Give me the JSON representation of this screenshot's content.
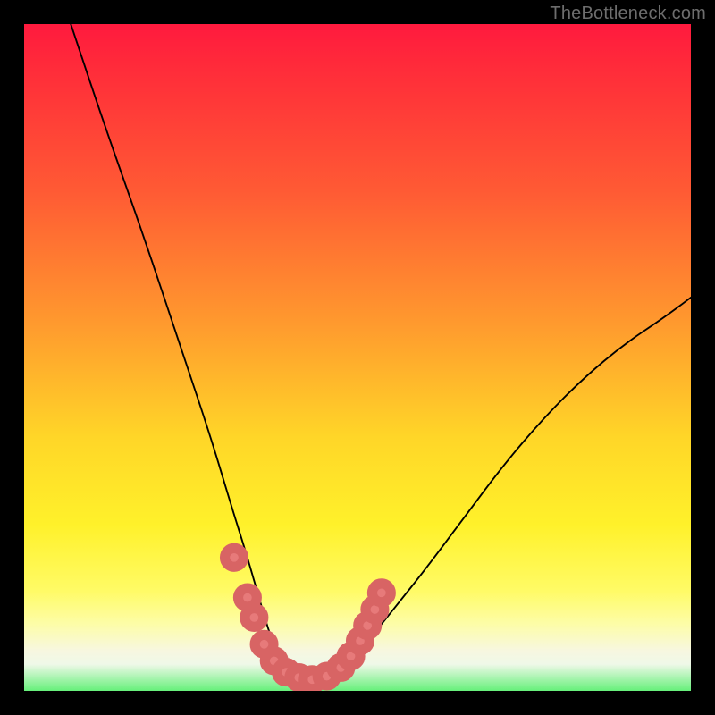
{
  "watermark": "TheBottleneck.com",
  "colors": {
    "frame": "#000000",
    "gradient_stops": [
      "#ff1a3e",
      "#ff2a3a",
      "#ff5a34",
      "#ff9a2e",
      "#ffd628",
      "#fff12a",
      "#fffb66",
      "#fdfda8",
      "#f7f7e0",
      "#eff8e8",
      "#66f07a"
    ],
    "curve": "#000000",
    "marker_fill": "#e77a7a",
    "marker_stroke": "#d86464"
  },
  "chart_data": {
    "type": "line",
    "title": "",
    "xlabel": "",
    "ylabel": "",
    "xlim": [
      0,
      100
    ],
    "ylim": [
      0,
      100
    ],
    "grid": false,
    "legend": false,
    "note": "percent-of-plot coordinates (0,0)=top-left; x/y are 0–100",
    "series": [
      {
        "name": "bottleneck-curve",
        "x": [
          7,
          12,
          18,
          24,
          28,
          31,
          33.5,
          35.5,
          37,
          38.5,
          40,
          42.5,
          45,
          48,
          52,
          56,
          60,
          66,
          72,
          78,
          84,
          90,
          96,
          100
        ],
        "y": [
          0,
          15,
          32,
          50,
          62,
          72,
          80,
          87,
          92,
          95.5,
          97.2,
          98.2,
          98,
          96,
          92,
          87,
          82,
          74,
          66,
          59,
          53,
          48,
          44,
          41
        ]
      }
    ],
    "markers": {
      "name": "highlight-dots",
      "radius_pct": 1.4,
      "points": [
        {
          "x": 31.5,
          "y": 80
        },
        {
          "x": 33.5,
          "y": 86
        },
        {
          "x": 34.5,
          "y": 89
        },
        {
          "x": 36.0,
          "y": 93
        },
        {
          "x": 37.5,
          "y": 95.5
        },
        {
          "x": 39.3,
          "y": 97.2
        },
        {
          "x": 41.2,
          "y": 98.0
        },
        {
          "x": 43.2,
          "y": 98.3
        },
        {
          "x": 45.4,
          "y": 97.8
        },
        {
          "x": 47.5,
          "y": 96.5
        },
        {
          "x": 49.0,
          "y": 94.8
        },
        {
          "x": 50.4,
          "y": 92.5
        },
        {
          "x": 51.5,
          "y": 90.2
        },
        {
          "x": 52.6,
          "y": 87.8
        },
        {
          "x": 53.6,
          "y": 85.3
        }
      ]
    }
  }
}
